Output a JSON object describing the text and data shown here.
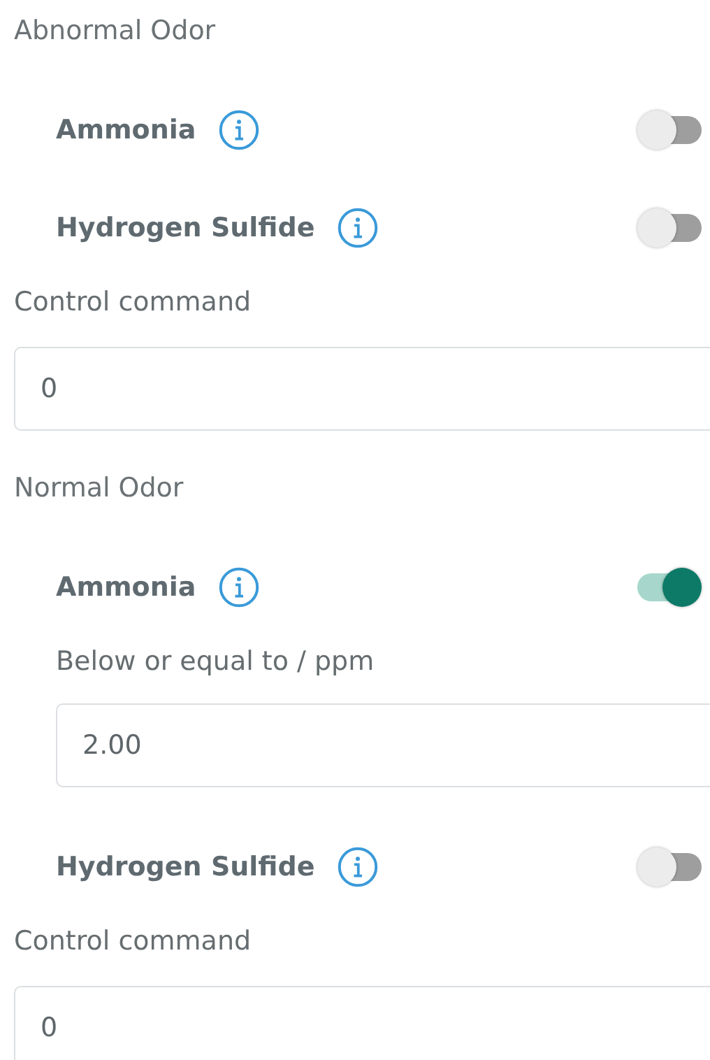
{
  "sections": [
    {
      "title": "Abnormal Odor",
      "sensors": [
        {
          "name": "Ammonia",
          "on": false
        },
        {
          "name": "Hydrogen Sulfide",
          "on": false
        }
      ],
      "command": {
        "label": "Control command",
        "value": "0"
      }
    },
    {
      "title": "Normal Odor",
      "sensors": [
        {
          "name": "Ammonia",
          "on": true,
          "threshold": {
            "label": "Below or equal to / ppm",
            "value": "2.00"
          }
        },
        {
          "name": "Hydrogen Sulfide",
          "on": false
        }
      ],
      "command": {
        "label": "Control command",
        "value": "0"
      }
    }
  ]
}
